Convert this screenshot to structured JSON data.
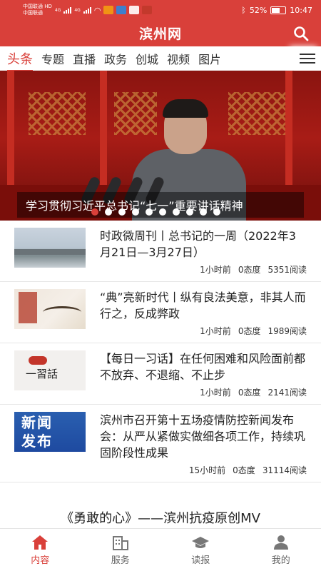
{
  "status_bar": {
    "carrier_1": "中国联通",
    "carrier_1_tag": "HD",
    "carrier_2": "中国联通",
    "network_1": "4G",
    "network_2": "4G",
    "battery": "52%",
    "time": "10:47"
  },
  "header": {
    "title": "滨州网",
    "search_icon": "search-icon"
  },
  "tabs": [
    {
      "label": "头条",
      "active": true
    },
    {
      "label": "专题"
    },
    {
      "label": "直播"
    },
    {
      "label": "政务"
    },
    {
      "label": "创城"
    },
    {
      "label": "视频"
    },
    {
      "label": "图片"
    }
  ],
  "banner": {
    "caption": "学习贯彻习近平总书记“七一”重要讲话精神",
    "dots_total": 10,
    "active_dot": 1
  },
  "news": [
    {
      "title": "时政微周刊丨总书记的一周（2022年3月21日—3月27日）",
      "time": "1小时前",
      "attitude": "0态度",
      "reads": "5351阅读"
    },
    {
      "title": "“典”亮新时代丨纵有良法美意，非其人而行之，反成弊政",
      "time": "1小时前",
      "attitude": "0态度",
      "reads": "1989阅读"
    },
    {
      "title": "【每日一习话】在任何困难和风险面前都不放弃、不退缩、不止步",
      "time": "1小时前",
      "attitude": "0态度",
      "reads": "2141阅读"
    },
    {
      "title": "滨州市召开第十五场疫情防控新闻发布会：从严从紧做实做细各项工作，持续巩固阶段性成果",
      "time": "15小时前",
      "attitude": "0态度",
      "reads": "31114阅读"
    }
  ],
  "thumbs": {
    "t3_text": "一習話",
    "t4_line1": "新闻",
    "t4_line2": "发布"
  },
  "mv_title": "《勇敢的心》——滨州抗疫原创MV",
  "bottom_nav": [
    {
      "label": "内容",
      "icon": "home-icon",
      "active": true
    },
    {
      "label": "服务",
      "icon": "building-icon"
    },
    {
      "label": "读报",
      "icon": "graduation-cap-icon"
    },
    {
      "label": "我的",
      "icon": "user-icon"
    }
  ],
  "colors": {
    "brand": "#d9403a"
  }
}
